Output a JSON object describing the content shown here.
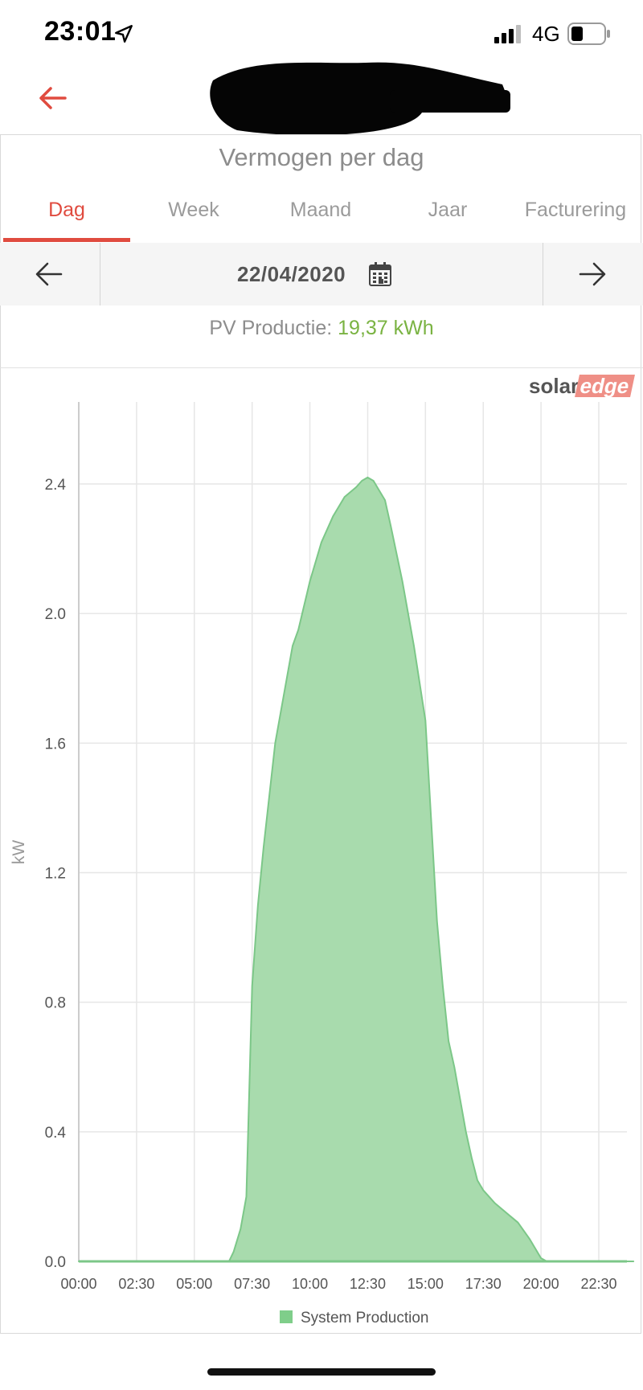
{
  "status_bar": {
    "time": "23:01",
    "network": "4G",
    "icons": [
      "location-arrow-icon",
      "signal-bars-icon",
      "battery-icon"
    ]
  },
  "nav": {
    "back_icon": "arrow-left-icon",
    "title_redacted": true
  },
  "page": {
    "title": "Vermogen per dag",
    "tabs": [
      {
        "label": "Dag",
        "active": true
      },
      {
        "label": "Week",
        "active": false
      },
      {
        "label": "Maand",
        "active": false
      },
      {
        "label": "Jaar",
        "active": false
      },
      {
        "label": "Facturering",
        "active": false
      }
    ],
    "date": "22/04/2020",
    "production_label": "PV Productie:",
    "production_value": "19,37 kWh",
    "brand": {
      "part1": "solar",
      "part2": "edge"
    }
  },
  "colors": {
    "accent": "#e04b3f",
    "production_green": "#7ab342",
    "area_fill": "#a8dbad",
    "area_stroke": "#7cc788",
    "grid": "#e6e6e6"
  },
  "chart_data": {
    "type": "area",
    "ylabel": "kW",
    "xlabel": "",
    "x_ticks": [
      "00:00",
      "02:30",
      "05:00",
      "07:30",
      "10:00",
      "12:30",
      "15:00",
      "17:30",
      "20:00",
      "22:30"
    ],
    "y_ticks": [
      "0.0",
      "0.4",
      "0.8",
      "1.2",
      "1.6",
      "2.0",
      "2.4"
    ],
    "ylim": [
      0,
      2.65
    ],
    "xlim_hours": [
      0,
      24
    ],
    "grid": true,
    "legend_position": "bottom-center",
    "series": [
      {
        "name": "System Production",
        "x_hours": [
          0,
          6.5,
          6.7,
          7.0,
          7.25,
          7.5,
          7.75,
          8.0,
          8.5,
          9.0,
          9.25,
          9.5,
          10.0,
          10.5,
          11.0,
          11.5,
          12.0,
          12.25,
          12.5,
          12.75,
          13.0,
          13.25,
          13.5,
          14.0,
          14.5,
          15.0,
          15.5,
          15.75,
          16.0,
          16.25,
          16.5,
          16.75,
          17.0,
          17.25,
          17.5,
          17.75,
          18.0,
          18.5,
          19.0,
          19.5,
          20.0,
          20.25,
          24
        ],
        "values": [
          0,
          0,
          0.03,
          0.1,
          0.2,
          0.85,
          1.1,
          1.28,
          1.6,
          1.8,
          1.9,
          1.95,
          2.1,
          2.22,
          2.3,
          2.36,
          2.39,
          2.41,
          2.42,
          2.41,
          2.38,
          2.35,
          2.27,
          2.1,
          1.9,
          1.67,
          1.05,
          0.85,
          0.68,
          0.6,
          0.5,
          0.4,
          0.32,
          0.25,
          0.22,
          0.2,
          0.18,
          0.15,
          0.12,
          0.07,
          0.01,
          0,
          0
        ]
      }
    ]
  }
}
